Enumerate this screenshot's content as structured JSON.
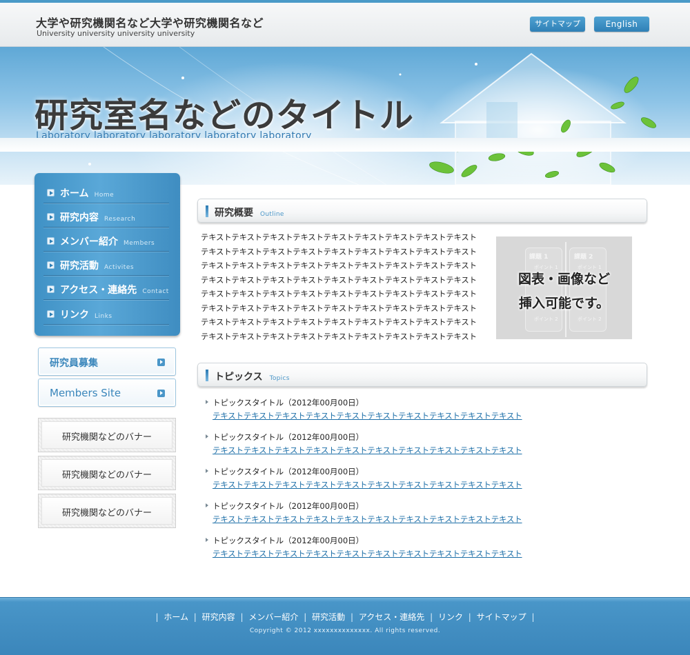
{
  "header": {
    "site_title": "大学や研究機関名など大学や研究機関名など",
    "site_subtitle": "University university university university",
    "sitemap_label": "サイトマップ",
    "english_label": "English"
  },
  "hero": {
    "title": "研究室名などのタイトル",
    "subtitle": "Laboratory laboratory laboratory laboratory laboratory"
  },
  "nav": {
    "items": [
      {
        "label": "ホーム",
        "en": "Home"
      },
      {
        "label": "研究内容",
        "en": "Research"
      },
      {
        "label": "メンバー紹介",
        "en": "Members"
      },
      {
        "label": "研究活動",
        "en": "Activites"
      },
      {
        "label": "アクセス・連絡先",
        "en": "Contact"
      },
      {
        "label": "リンク",
        "en": "Links"
      }
    ]
  },
  "side_buttons": {
    "recruit": "研究員募集",
    "members_site": "Members Site"
  },
  "banners": [
    "研究機関などのバナー",
    "研究機関などのバナー",
    "研究機関などのバナー"
  ],
  "outline": {
    "heading": "研究概要",
    "heading_en": "Outline",
    "lines": [
      "テキストテキストテキストテキストテキストテキストテキストテキストテキスト",
      "テキストテキストテキストテキストテキストテキストテキストテキストテキスト",
      "テキストテキストテキストテキストテキストテキストテキストテキストテキスト",
      "テキストテキストテキストテキストテキストテキストテキストテキストテキスト",
      "テキストテキストテキストテキストテキストテキストテキストテキストテキスト",
      "テキストテキストテキストテキストテキストテキストテキストテキストテキスト",
      "テキストテキストテキストテキストテキストテキストテキストテキストテキスト",
      "テキストテキストテキストテキストテキストテキストテキストテキストテキスト"
    ],
    "figure": {
      "caption_line1": "図表・画像など",
      "caption_line2": "挿入可能です。",
      "card1_title": "課題 1",
      "card2_title": "課題 2",
      "point1": "ポイント 1",
      "point2": "ポイント 2"
    }
  },
  "topics": {
    "heading": "トピックス",
    "heading_en": "Topics",
    "items": [
      {
        "title": "トピックスタイトル（2012年00月00日）",
        "text": "テキストテキストテキストテキストテキストテキストテキストテキストテキストテキスト"
      },
      {
        "title": "トピックスタイトル（2012年00月00日）",
        "text": "テキストテキストテキストテキストテキストテキストテキストテキストテキストテキスト"
      },
      {
        "title": "トピックスタイトル（2012年00月00日）",
        "text": "テキストテキストテキストテキストテキストテキストテキストテキストテキストテキスト"
      },
      {
        "title": "トピックスタイトル（2012年00月00日）",
        "text": "テキストテキストテキストテキストテキストテキストテキストテキストテキストテキスト"
      },
      {
        "title": "トピックスタイトル（2012年00月00日）",
        "text": "テキストテキストテキストテキストテキストテキストテキストテキストテキストテキスト"
      }
    ]
  },
  "footer": {
    "links": [
      "ホーム",
      "研究内容",
      "メンバー紹介",
      "研究活動",
      "アクセス・連絡先",
      "リンク",
      "サイトマップ"
    ],
    "copyright": "Copyright © 2012 xxxxxxxxxxxxxx. All rights reserved."
  },
  "colors": {
    "accent": "#3f8dc1",
    "link": "#1d6fa8",
    "footer": "#4a97c9"
  }
}
